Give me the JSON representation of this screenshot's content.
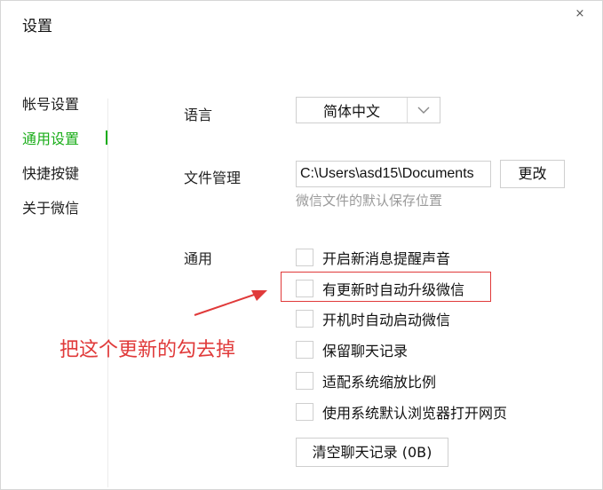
{
  "window": {
    "title": "设置",
    "close_symbol": "×"
  },
  "sidebar": {
    "items": [
      {
        "label": "帐号设置",
        "active": false
      },
      {
        "label": "通用设置",
        "active": true
      },
      {
        "label": "快捷按键",
        "active": false
      },
      {
        "label": "关于微信",
        "active": false
      }
    ]
  },
  "general": {
    "language": {
      "label": "语言",
      "value": "简体中文"
    },
    "file_management": {
      "label": "文件管理",
      "path": "C:\\Users\\asd15\\Documents",
      "change_button": "更改",
      "hint": "微信文件的默认保存位置"
    },
    "options": {
      "label": "通用",
      "items": [
        {
          "label": "开启新消息提醒声音",
          "checked": false
        },
        {
          "label": "有更新时自动升级微信",
          "checked": false
        },
        {
          "label": "开机时自动启动微信",
          "checked": false
        },
        {
          "label": "保留聊天记录",
          "checked": false
        },
        {
          "label": "适配系统缩放比例",
          "checked": false
        },
        {
          "label": "使用系统默认浏览器打开网页",
          "checked": false
        }
      ]
    },
    "clear_chat_button": "清空聊天记录 (0B)"
  },
  "annotation": {
    "text": "把这个更新的勾去掉",
    "color": "#e03a3a"
  },
  "colors": {
    "accent": "#1aad19",
    "annotation": "#e03a3a"
  }
}
